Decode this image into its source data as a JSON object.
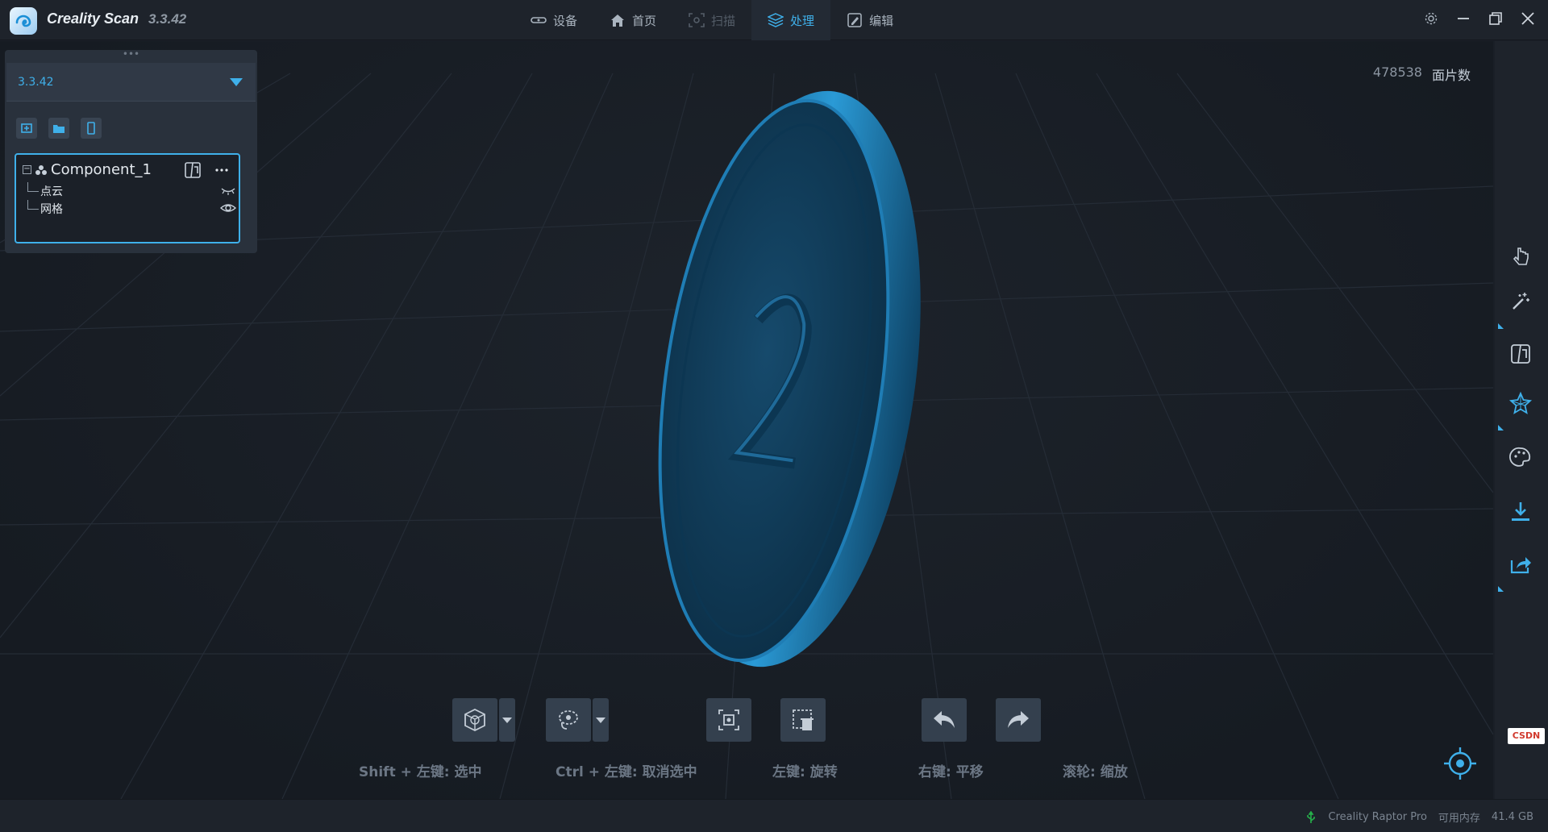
{
  "app": {
    "name": "Creality Scan",
    "version": "3.3.42"
  },
  "tabs": [
    {
      "label": "设备",
      "icon": "device-icon",
      "state": "normal"
    },
    {
      "label": "首页",
      "icon": "home-icon",
      "state": "normal"
    },
    {
      "label": "扫描",
      "icon": "scan-icon",
      "state": "disabled"
    },
    {
      "label": "处理",
      "icon": "layers-icon",
      "state": "active"
    },
    {
      "label": "编辑",
      "icon": "edit-icon",
      "state": "normal"
    }
  ],
  "panel": {
    "project_select": "3.3.42",
    "component": {
      "name": "Component_1",
      "children": [
        {
          "label": "点云",
          "visible": false
        },
        {
          "label": "网格",
          "visible": true
        }
      ]
    }
  },
  "stats": {
    "face_count": "478538",
    "face_label": "面片数"
  },
  "hints": {
    "select": "Shift + 左键: 选中",
    "deselect": "Ctrl + 左键: 取消选中",
    "rotate": "左键: 旋转",
    "pan": "右键: 平移",
    "zoom": "滚轮: 缩放"
  },
  "status": {
    "device": "Creality Raptor Pro",
    "memory_label": "可用内存",
    "memory_value": "41.4 GB"
  },
  "watermark": "CSDN",
  "colors": {
    "accent": "#3fb0ea",
    "coin": "#1d6d9c",
    "background": "#161b22"
  }
}
